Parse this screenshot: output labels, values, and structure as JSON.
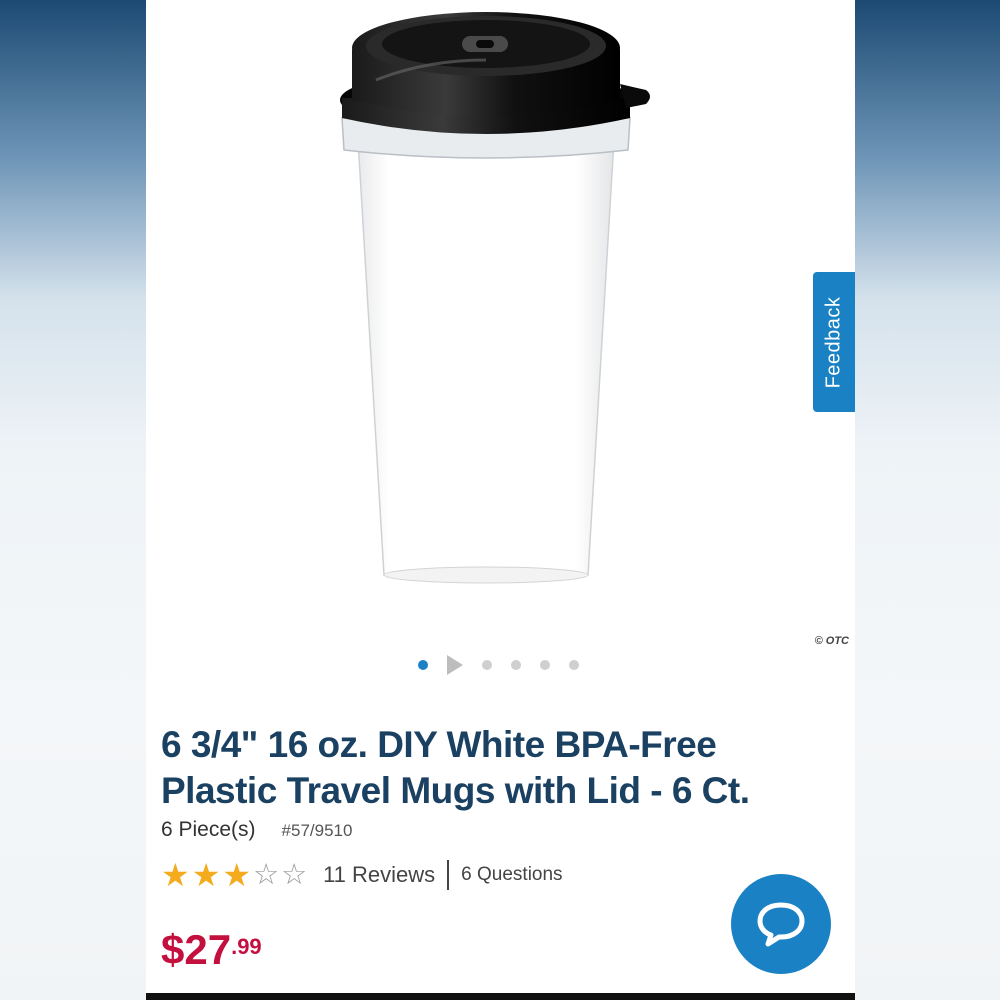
{
  "product": {
    "title": "6 3/4\" 16 oz. DIY White BPA-Free Plastic Travel Mugs with Lid - 6 Ct.",
    "quantity": "6 Piece(s)",
    "sku": "#57/9510",
    "rating": 3.5,
    "rating_max": 5,
    "reviews_label": "11 Reviews",
    "questions_label": "6 Questions",
    "price_dollars": "$27",
    "price_cents": ".99",
    "image_watermark": "© OTC"
  },
  "carousel": {
    "slide_count": 6,
    "active_index": 0,
    "video_slide_index": 1
  },
  "feedback_tab": {
    "label": "Feedback"
  },
  "colors": {
    "brand_blue": "#1a82c4",
    "title_navy": "#1b4162",
    "price_red": "#c3103e",
    "star_gold": "#f4ab1d"
  },
  "icons": {
    "chat": "chat-bubble-icon",
    "star": "star-icon",
    "play": "play-icon"
  }
}
